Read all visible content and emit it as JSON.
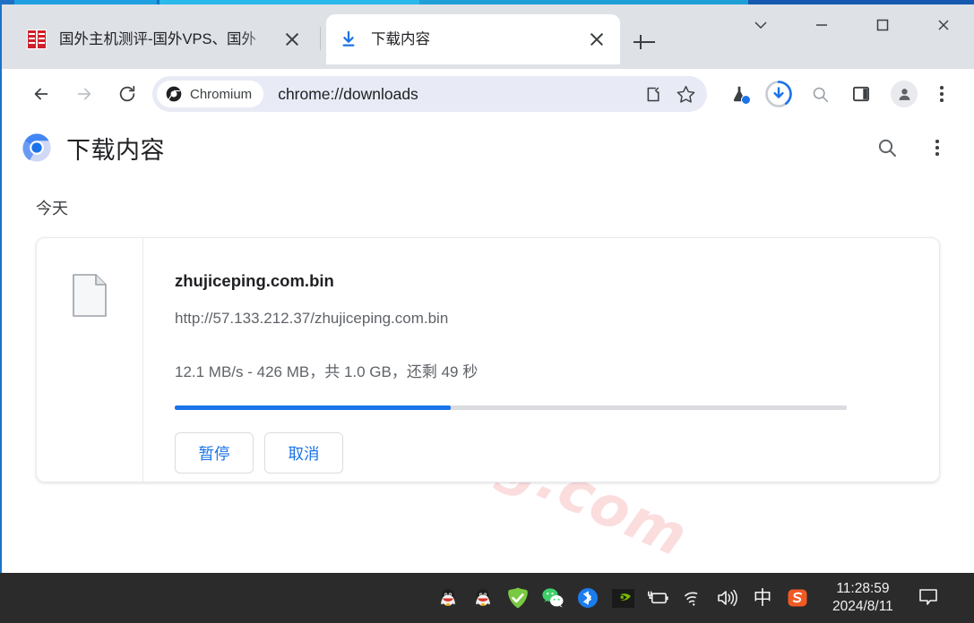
{
  "window": {
    "controls": [
      {
        "name": "tab-search",
        "glyph": "chevron-down"
      },
      {
        "name": "minimize",
        "glyph": "minimize"
      },
      {
        "name": "maximize",
        "glyph": "maximize"
      },
      {
        "name": "close",
        "glyph": "close"
      }
    ]
  },
  "tabs": [
    {
      "title": "国外主机测评-国外VPS、国外",
      "active": false,
      "favicon": "site-red-icon"
    },
    {
      "title": "下载内容",
      "active": true,
      "favicon": "download-blue-icon"
    }
  ],
  "newtab_label": "+",
  "toolbar": {
    "back_label": "back-arrow",
    "forward_label": "forward-arrow",
    "reload_label": "reload",
    "chip_label": "Chromium",
    "url": "chrome://downloads",
    "share_label": "share",
    "bookmark_label": "star",
    "flask_label": "experiments",
    "download_label": "downloads",
    "search_label": "search",
    "sidepanel_label": "side-panel",
    "profile_label": "profile",
    "menu_label": "more"
  },
  "downloads_page": {
    "title": "下载内容",
    "search_label": "搜索",
    "menu_label": "更多",
    "watermark": "zhujiceping.com",
    "day_label": "今天",
    "item": {
      "file_name": "zhujiceping.com.bin",
      "url": "http://57.133.212.37/zhujiceping.com.bin",
      "status": "12.1 MB/s - 426 MB，共 1.0 GB，还剩 49 秒",
      "speed": "12.1 MB/s",
      "received": "426 MB",
      "total": "1.0 GB",
      "remaining": "49 秒",
      "progress_percent": 41,
      "pause_label": "暂停",
      "cancel_label": "取消"
    }
  },
  "taskbar": {
    "tray_icons": [
      {
        "name": "qq-icon"
      },
      {
        "name": "qq-icon-2"
      },
      {
        "name": "security-check-icon"
      },
      {
        "name": "wechat-icon"
      },
      {
        "name": "bluetooth-icon"
      },
      {
        "name": "nvidia-icon"
      },
      {
        "name": "battery-icon"
      },
      {
        "name": "wifi-icon"
      },
      {
        "name": "volume-icon"
      },
      {
        "name": "ime-icon",
        "label": "中"
      },
      {
        "name": "sogou-icon",
        "label": "S"
      }
    ],
    "clock_time": "11:28:59",
    "clock_date": "2024/8/11",
    "notification_label": "notifications"
  },
  "colors": {
    "accent_blue": "#1a73e8",
    "tabstrip_bg": "#dee1e6",
    "watermark_pink": "#fbdddd",
    "taskbar_bg": "#2b2b2b"
  }
}
